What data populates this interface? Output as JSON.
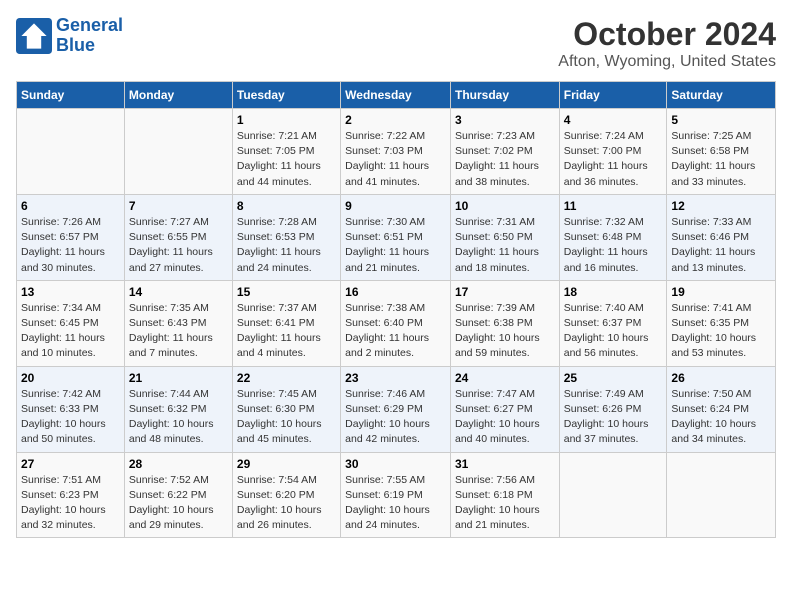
{
  "header": {
    "logo_line1": "General",
    "logo_line2": "Blue",
    "title": "October 2024",
    "subtitle": "Afton, Wyoming, United States"
  },
  "columns": [
    "Sunday",
    "Monday",
    "Tuesday",
    "Wednesday",
    "Thursday",
    "Friday",
    "Saturday"
  ],
  "weeks": [
    [
      {
        "day": "",
        "info": ""
      },
      {
        "day": "",
        "info": ""
      },
      {
        "day": "1",
        "info": "Sunrise: 7:21 AM\nSunset: 7:05 PM\nDaylight: 11 hours and 44 minutes."
      },
      {
        "day": "2",
        "info": "Sunrise: 7:22 AM\nSunset: 7:03 PM\nDaylight: 11 hours and 41 minutes."
      },
      {
        "day": "3",
        "info": "Sunrise: 7:23 AM\nSunset: 7:02 PM\nDaylight: 11 hours and 38 minutes."
      },
      {
        "day": "4",
        "info": "Sunrise: 7:24 AM\nSunset: 7:00 PM\nDaylight: 11 hours and 36 minutes."
      },
      {
        "day": "5",
        "info": "Sunrise: 7:25 AM\nSunset: 6:58 PM\nDaylight: 11 hours and 33 minutes."
      }
    ],
    [
      {
        "day": "6",
        "info": "Sunrise: 7:26 AM\nSunset: 6:57 PM\nDaylight: 11 hours and 30 minutes."
      },
      {
        "day": "7",
        "info": "Sunrise: 7:27 AM\nSunset: 6:55 PM\nDaylight: 11 hours and 27 minutes."
      },
      {
        "day": "8",
        "info": "Sunrise: 7:28 AM\nSunset: 6:53 PM\nDaylight: 11 hours and 24 minutes."
      },
      {
        "day": "9",
        "info": "Sunrise: 7:30 AM\nSunset: 6:51 PM\nDaylight: 11 hours and 21 minutes."
      },
      {
        "day": "10",
        "info": "Sunrise: 7:31 AM\nSunset: 6:50 PM\nDaylight: 11 hours and 18 minutes."
      },
      {
        "day": "11",
        "info": "Sunrise: 7:32 AM\nSunset: 6:48 PM\nDaylight: 11 hours and 16 minutes."
      },
      {
        "day": "12",
        "info": "Sunrise: 7:33 AM\nSunset: 6:46 PM\nDaylight: 11 hours and 13 minutes."
      }
    ],
    [
      {
        "day": "13",
        "info": "Sunrise: 7:34 AM\nSunset: 6:45 PM\nDaylight: 11 hours and 10 minutes."
      },
      {
        "day": "14",
        "info": "Sunrise: 7:35 AM\nSunset: 6:43 PM\nDaylight: 11 hours and 7 minutes."
      },
      {
        "day": "15",
        "info": "Sunrise: 7:37 AM\nSunset: 6:41 PM\nDaylight: 11 hours and 4 minutes."
      },
      {
        "day": "16",
        "info": "Sunrise: 7:38 AM\nSunset: 6:40 PM\nDaylight: 11 hours and 2 minutes."
      },
      {
        "day": "17",
        "info": "Sunrise: 7:39 AM\nSunset: 6:38 PM\nDaylight: 10 hours and 59 minutes."
      },
      {
        "day": "18",
        "info": "Sunrise: 7:40 AM\nSunset: 6:37 PM\nDaylight: 10 hours and 56 minutes."
      },
      {
        "day": "19",
        "info": "Sunrise: 7:41 AM\nSunset: 6:35 PM\nDaylight: 10 hours and 53 minutes."
      }
    ],
    [
      {
        "day": "20",
        "info": "Sunrise: 7:42 AM\nSunset: 6:33 PM\nDaylight: 10 hours and 50 minutes."
      },
      {
        "day": "21",
        "info": "Sunrise: 7:44 AM\nSunset: 6:32 PM\nDaylight: 10 hours and 48 minutes."
      },
      {
        "day": "22",
        "info": "Sunrise: 7:45 AM\nSunset: 6:30 PM\nDaylight: 10 hours and 45 minutes."
      },
      {
        "day": "23",
        "info": "Sunrise: 7:46 AM\nSunset: 6:29 PM\nDaylight: 10 hours and 42 minutes."
      },
      {
        "day": "24",
        "info": "Sunrise: 7:47 AM\nSunset: 6:27 PM\nDaylight: 10 hours and 40 minutes."
      },
      {
        "day": "25",
        "info": "Sunrise: 7:49 AM\nSunset: 6:26 PM\nDaylight: 10 hours and 37 minutes."
      },
      {
        "day": "26",
        "info": "Sunrise: 7:50 AM\nSunset: 6:24 PM\nDaylight: 10 hours and 34 minutes."
      }
    ],
    [
      {
        "day": "27",
        "info": "Sunrise: 7:51 AM\nSunset: 6:23 PM\nDaylight: 10 hours and 32 minutes."
      },
      {
        "day": "28",
        "info": "Sunrise: 7:52 AM\nSunset: 6:22 PM\nDaylight: 10 hours and 29 minutes."
      },
      {
        "day": "29",
        "info": "Sunrise: 7:54 AM\nSunset: 6:20 PM\nDaylight: 10 hours and 26 minutes."
      },
      {
        "day": "30",
        "info": "Sunrise: 7:55 AM\nSunset: 6:19 PM\nDaylight: 10 hours and 24 minutes."
      },
      {
        "day": "31",
        "info": "Sunrise: 7:56 AM\nSunset: 6:18 PM\nDaylight: 10 hours and 21 minutes."
      },
      {
        "day": "",
        "info": ""
      },
      {
        "day": "",
        "info": ""
      }
    ]
  ]
}
